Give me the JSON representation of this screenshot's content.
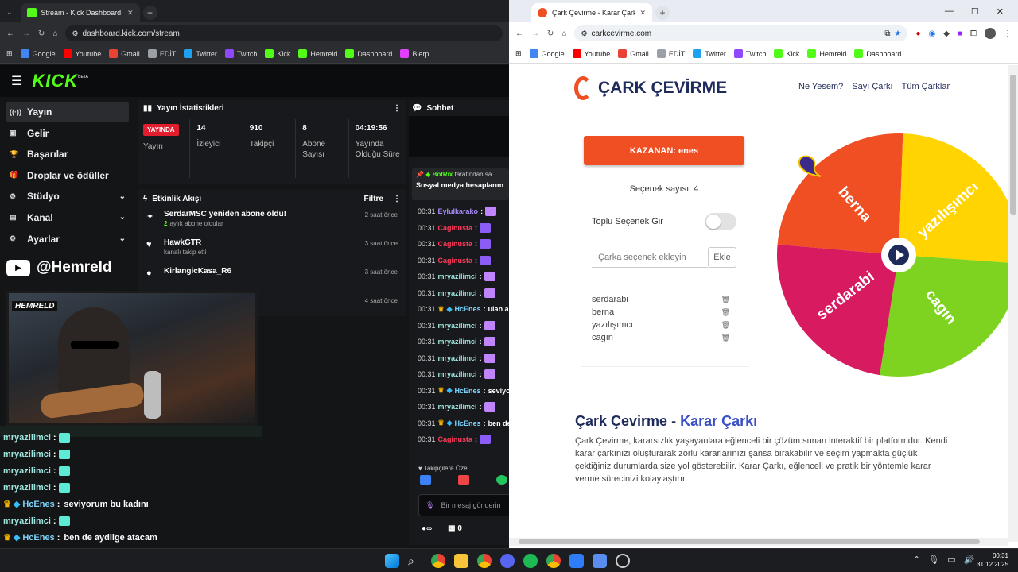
{
  "left_browser": {
    "tab_title": "Stream - Kick Dashboard",
    "url": "dashboard.kick.com/stream",
    "bookmarks": [
      "Google",
      "Youtube",
      "Gmail",
      "EDİT",
      "Twitter",
      "Twitch",
      "Kick",
      "Hemreld",
      "Dashboard",
      "Blerp"
    ]
  },
  "kick": {
    "logo": "KICK",
    "logo_beta": "BETA",
    "sidebar": [
      {
        "label": "Yayın",
        "icon": "broadcast-icon",
        "active": true
      },
      {
        "label": "Gelir",
        "icon": "income-icon"
      },
      {
        "label": "Başarılar",
        "icon": "trophy-icon"
      },
      {
        "label": "Droplar ve ödüller",
        "icon": "gift-icon"
      },
      {
        "label": "Stüdyo",
        "icon": "studio-icon",
        "expand": true
      },
      {
        "label": "Kanal",
        "icon": "channel-icon",
        "expand": true
      },
      {
        "label": "Ayarlar",
        "icon": "gear-icon",
        "expand": true
      }
    ],
    "yt_handle": "@Hemreld",
    "cam_tag": "HEMRELD",
    "stats": {
      "title": "Yayın İstatistikleri",
      "live_badge": "YAYINDA",
      "live_label": "Yayın",
      "items": [
        {
          "value": "14",
          "label": "İzleyici"
        },
        {
          "value": "910",
          "label": "Takipçi"
        },
        {
          "value": "8",
          "label": "Abone Sayısı"
        },
        {
          "value": "04:19:56",
          "label": "Yayında Olduğu Süre"
        }
      ]
    },
    "activity": {
      "title": "Etkinlik Akışı",
      "filter": "Filtre",
      "items": [
        {
          "name": "SerdarMSC yeniden abone oldu!",
          "sub_prefix": "2",
          "sub": "aylık abone oldular",
          "time": "2 saat önce"
        },
        {
          "name": "HawkGTR",
          "sub": "kanalı takip etti",
          "time": "3 saat önce"
        },
        {
          "name": "KirlangicKasa_R6",
          "sub": "",
          "time": "3 saat önce"
        },
        {
          "name": "",
          "sub": "",
          "time": "4 saat önce"
        }
      ]
    },
    "chat": {
      "title": "Sohbet",
      "pinned_user": "BotRix",
      "pinned_suffix": "tarafından sa",
      "pinned_text": "Sosyal medya hesaplarım",
      "lines": [
        {
          "time": "00:31",
          "user": "Eylulkarako",
          "color": "#a78bfa",
          "text": ""
        },
        {
          "time": "00:31",
          "user": "Caginusta",
          "color": "#ff3b5c",
          "text": ""
        },
        {
          "time": "00:31",
          "user": "Caginusta",
          "color": "#ff3b5c",
          "text": ""
        },
        {
          "time": "00:31",
          "user": "Caginusta",
          "color": "#ff3b5c",
          "text": ""
        },
        {
          "time": "00:31",
          "user": "mryazilimci",
          "color": "#9ee7e0",
          "text": ""
        },
        {
          "time": "00:31",
          "user": "mryazilimci",
          "color": "#9ee7e0",
          "text": ""
        },
        {
          "time": "00:31",
          "user": "HcEnes",
          "color": "#7dd3fc",
          "text": "ulan a"
        },
        {
          "time": "00:31",
          "user": "mryazilimci",
          "color": "#9ee7e0",
          "text": ""
        },
        {
          "time": "00:31",
          "user": "mryazilimci",
          "color": "#9ee7e0",
          "text": ""
        },
        {
          "time": "00:31",
          "user": "mryazilimci",
          "color": "#9ee7e0",
          "text": ""
        },
        {
          "time": "00:31",
          "user": "mryazilimci",
          "color": "#9ee7e0",
          "text": ""
        },
        {
          "time": "00:31",
          "user": "HcEnes",
          "color": "#7dd3fc",
          "text": "seviyo"
        },
        {
          "time": "00:31",
          "user": "mryazilimci",
          "color": "#9ee7e0",
          "text": ""
        },
        {
          "time": "00:31",
          "user": "HcEnes",
          "color": "#7dd3fc",
          "text": "ben de"
        },
        {
          "time": "00:31",
          "user": "Caginusta",
          "color": "#ff3b5c",
          "text": ""
        }
      ],
      "followers_only": "Takipçilere Özel",
      "input_placeholder": "Bir mesaj gönderin",
      "footer_count": "0"
    },
    "overlay_chat": [
      {
        "user": "mryazilimci",
        "color": "#9ee7e0",
        "text": ""
      },
      {
        "user": "mryazilimci",
        "color": "#9ee7e0",
        "text": ""
      },
      {
        "user": "mryazilimci",
        "color": "#9ee7e0",
        "text": ""
      },
      {
        "user": "mryazilimci",
        "color": "#9ee7e0",
        "text": ""
      },
      {
        "user": "HcEnes",
        "color": "#7dd3fc",
        "text": "seviyorum bu kadını"
      },
      {
        "user": "mryazilimci",
        "color": "#9ee7e0",
        "text": ""
      },
      {
        "user": "HcEnes",
        "color": "#7dd3fc",
        "text": "ben de aydilge atacam"
      },
      {
        "user": "Caginusta",
        "color": "#ff3b5c",
        "text": ""
      }
    ]
  },
  "right_browser": {
    "tab_title": "Çark Çevirme - Karar Çarkı!",
    "url": "carkcevirme.com",
    "bookmarks": [
      "Google",
      "Youtube",
      "Gmail",
      "EDİT",
      "Twitter",
      "Twitch",
      "Kick",
      "Hemreld",
      "Dashboard"
    ]
  },
  "site": {
    "logo_text": "ÇARK ÇEVİRME",
    "nav": [
      "Ne Yesem?",
      "Sayı Çarkı",
      "Tüm Çarklar"
    ],
    "winner": "KAZANAN: enes",
    "option_count": "Seçenek sayısı: 4",
    "bulk_label": "Toplu Seçenek Gir",
    "input_placeholder": "Çarka seçenek ekleyin",
    "add_button": "Ekle",
    "options": [
      "serdarabi",
      "berna",
      "yazılışımcı",
      "cagın"
    ],
    "heading_main": "Çark Çevirme",
    "heading_sep": "-",
    "heading_sub": "Karar Çarkı",
    "description": "Çark Çevirme, kararsızlık yaşayanlara eğlenceli bir çözüm sunan interaktif bir platformdur. Kendi karar çarkınızı oluşturarak zorlu kararlarınızı şansa bırakabilir ve seçim yapmakta güçlük çektiğiniz durumlarda size yol gösterebilir. Karar Çarkı, eğlenceli ve pratik bir yöntemle karar verme sürecinizi kolaylaştırır.",
    "wheel": [
      {
        "label": "berna",
        "color": "#f04e23"
      },
      {
        "label": "yazılışımcı",
        "color": "#ffd400"
      },
      {
        "label": "cagın",
        "color": "#7ed321"
      },
      {
        "label": "serdarabi",
        "color": "#d81b60"
      }
    ]
  },
  "taskbar": {
    "time": "00:31",
    "date": "31.12.2025"
  }
}
